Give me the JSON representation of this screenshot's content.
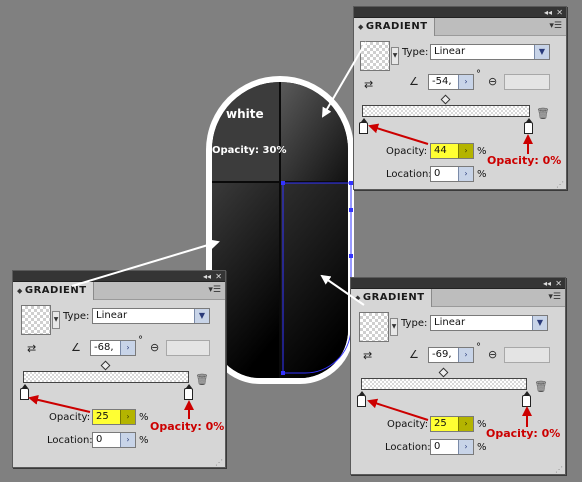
{
  "artwork": {
    "segment_label": "white",
    "opacity_note": "Opacity: 30%"
  },
  "panels": [
    {
      "title": "GRADIENT",
      "type_label": "Type:",
      "type_value": "Linear",
      "angle_value": "-54,",
      "angle_unit": "°",
      "opacity_label": "Opacity:",
      "opacity_value": "44",
      "opacity_unit": "%",
      "location_label": "Location:",
      "location_value": "0",
      "location_unit": "%",
      "end_note": "Opacity: 0%",
      "icons": [
        "collapse-icon",
        "panel-menu-icon",
        "swatch-dropdown-icon",
        "reverse-gradient-icon",
        "angle-icon",
        "aspect-ratio-icon",
        "delete-stop-icon"
      ]
    },
    {
      "title": "GRADIENT",
      "type_label": "Type:",
      "type_value": "Linear",
      "angle_value": "-68,",
      "angle_unit": "°",
      "opacity_label": "Opacity:",
      "opacity_value": "25",
      "opacity_unit": "%",
      "location_label": "Location:",
      "location_value": "0",
      "location_unit": "%",
      "end_note": "Opacity: 0%"
    },
    {
      "title": "GRADIENT",
      "type_label": "Type:",
      "type_value": "Linear",
      "angle_value": "-69,",
      "angle_unit": "°",
      "opacity_label": "Opacity:",
      "opacity_value": "25",
      "opacity_unit": "%",
      "location_label": "Location:",
      "location_value": "0",
      "location_unit": "%",
      "end_note": "Opacity: 0%"
    }
  ],
  "colors": {
    "background": "#808080",
    "highlight": "#ffff33",
    "annotation": "#cc0000",
    "selection": "#3333ff"
  }
}
